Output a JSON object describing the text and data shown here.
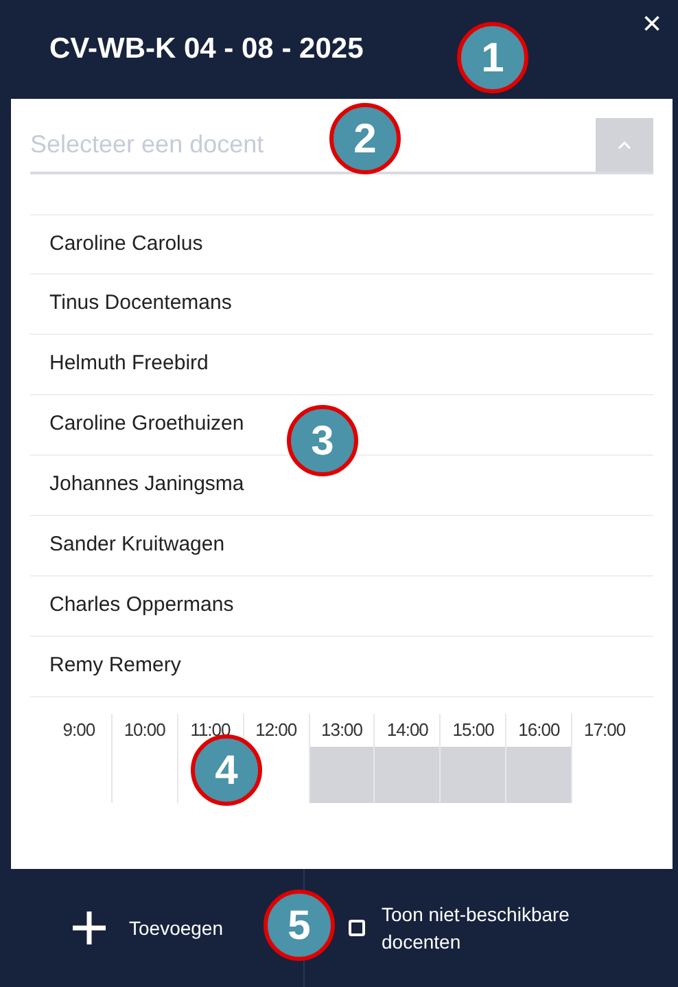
{
  "header": {
    "title": "CV-WB-K 04 - 08 - 2025",
    "close": "×"
  },
  "teacher_select": {
    "placeholder": "Selecteer een docent",
    "expanded": true
  },
  "teachers": [
    {
      "name": "Caroline Carolus"
    },
    {
      "name": "Tinus Docentemans"
    },
    {
      "name": "Helmuth Freebird"
    },
    {
      "name": "Caroline Groethuizen"
    },
    {
      "name": "Johannes Janingsma"
    },
    {
      "name": "Sander Kruitwagen"
    },
    {
      "name": "Charles Oppermans"
    },
    {
      "name": "Remy Remery"
    }
  ],
  "timeline": [
    {
      "hour": "9:00",
      "busy": false
    },
    {
      "hour": "10:00",
      "busy": false
    },
    {
      "hour": "11:00",
      "busy": false
    },
    {
      "hour": "12:00",
      "busy": false
    },
    {
      "hour": "13:00",
      "busy": true
    },
    {
      "hour": "14:00",
      "busy": true
    },
    {
      "hour": "15:00",
      "busy": true
    },
    {
      "hour": "16:00",
      "busy": true
    },
    {
      "hour": "17:00",
      "busy": false
    }
  ],
  "footer": {
    "add_button": "Toevoegen",
    "show_unavailable": {
      "label": "Toon niet-beschikbare docenten",
      "checked": false
    }
  },
  "callouts": [
    "1",
    "2",
    "3",
    "4",
    "5"
  ]
}
